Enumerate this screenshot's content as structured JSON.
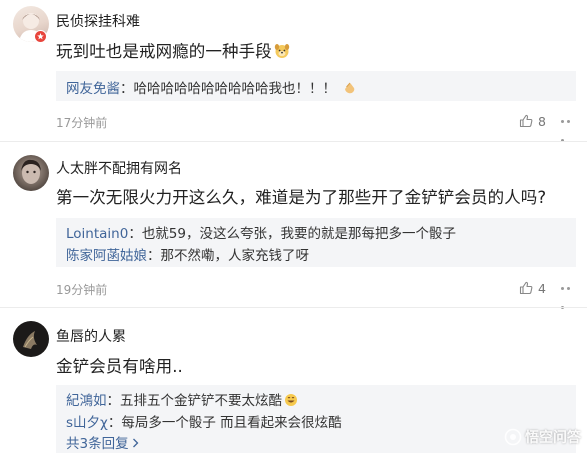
{
  "comments": [
    {
      "username": "民侦探挂科难",
      "content": "玩到吐也是戒网瘾的一种手段",
      "replies": [
        {
          "name": "网友免酱",
          "sep": "：",
          "text": "哈哈哈哈哈哈哈哈哈哈我也！！！"
        }
      ],
      "time": "17分钟前",
      "likes": "8"
    },
    {
      "username": "人太胖不配拥有网名",
      "content": "第一次无限火力开这么久，难道是为了那些开了金铲铲会员的人吗?",
      "replies": [
        {
          "name": "Lointain0",
          "sep": "：",
          "text": "也就59，没这么夸张，我要的就是那每把多一个骰子"
        },
        {
          "name": "陈家阿菡姑娘",
          "sep": "：",
          "text": "那不然嘞，人家充钱了呀"
        }
      ],
      "time": "19分钟前",
      "likes": "4"
    },
    {
      "username": "鱼唇的人累",
      "content": "金铲会员有啥用..",
      "replies": [
        {
          "name": "紀鴻如",
          "sep": "：",
          "text": "五排五个金铲铲不要太炫酷"
        },
        {
          "name": "s山夕χ",
          "sep": "：",
          "text": "每局多一个骰子 而且看起来会很炫酷"
        }
      ],
      "more_replies": "共3条回复"
    }
  ],
  "watermark": "悟空问答",
  "colors": {
    "reply_name": "#406599",
    "reply_bg": "#f4f5f7",
    "meta_text": "#999999"
  },
  "icons": {
    "emoji_1": "emoji-dog-icon",
    "emoji_2": "emoji-clap-icon",
    "emoji_3": "emoji-grin-icon",
    "like": "thumbs-up-icon",
    "more": "more-dots-icon"
  }
}
